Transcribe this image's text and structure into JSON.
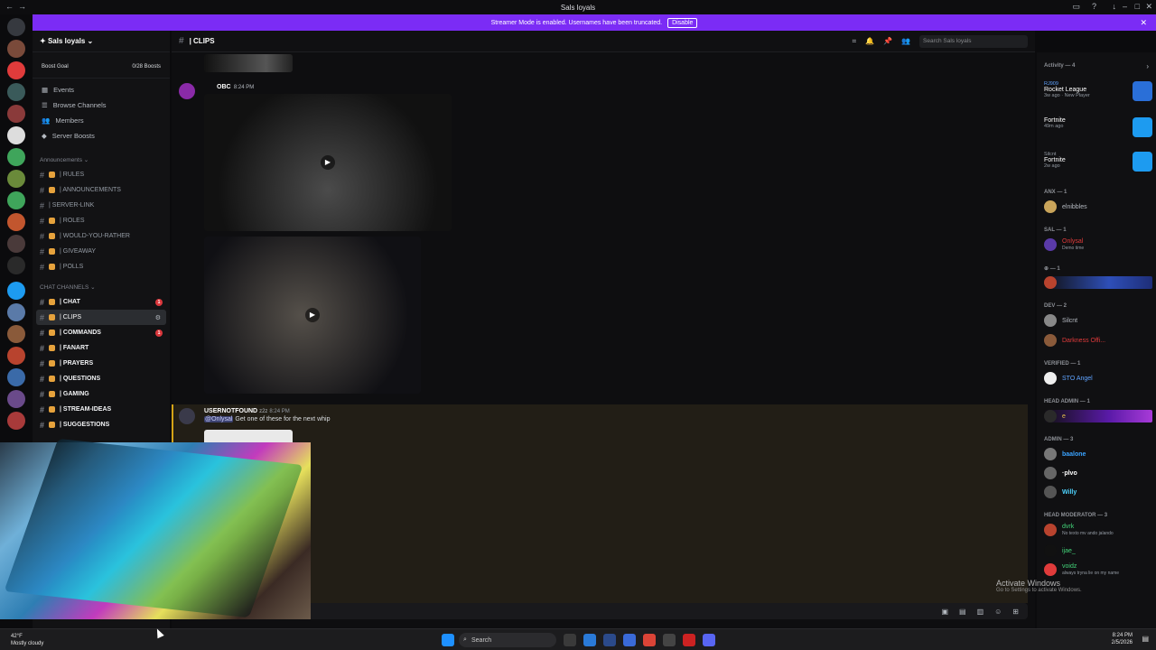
{
  "window": {
    "title": "Sals loyals"
  },
  "banner": {
    "text": "Streamer Mode is enabled. Usernames have been truncated.",
    "button": "Disable"
  },
  "guild": {
    "name": "Sals loyals",
    "boost_label": "Boost Goal",
    "boost_value": "0/28 Boosts"
  },
  "nav": [
    "Events",
    "Browse Channels",
    "Members",
    "Server Boosts"
  ],
  "categories": {
    "announcements": "Announcements",
    "chat": "CHAT CHANNELS"
  },
  "announce_channels": [
    "| RULES",
    "| ANNOUNCEMENTS",
    "| SERVER-LINK",
    "| ROLES",
    "| WOULD-YOU-RATHER",
    "| GIVEAWAY",
    "| POLLS"
  ],
  "chat_channels": [
    "| CHAT",
    "| CLIPS",
    "| COMMANDS",
    "| FANART",
    "| PRAYERS",
    "| QUESTIONS",
    "| GAMING",
    "| STREAM-IDEAS",
    "| SUGGESTIONS"
  ],
  "badges": {
    "chat": "1",
    "commands": "1"
  },
  "header": {
    "channel": "| CLIPS",
    "search_placeholder": "Search Sals loyals"
  },
  "messages": [
    {
      "author": "OBC",
      "time": "8:24 PM"
    },
    {
      "author": "USERNOTFOUND",
      "tag": "z2z",
      "time": "8:24 PM",
      "mention": "@Onlysal",
      "text": "Get one of these for the next whip"
    }
  ],
  "members": {
    "activity_header": "Activity — 4",
    "activities": [
      {
        "user": "RJ909",
        "game": "Rocket League",
        "sub": "3w ago · New Player"
      },
      {
        "user": "",
        "game": "Fortnite",
        "sub": "49m ago"
      },
      {
        "user": "Silcnt",
        "game": "Fortnite",
        "sub": "2w ago"
      }
    ],
    "sections": [
      {
        "title": "ANX — 1",
        "users": [
          {
            "name": "elnibbles",
            "color": "#b5bac1"
          }
        ]
      },
      {
        "title": "SAL — 1",
        "users": [
          {
            "name": "Onlysal",
            "color": "#e23b3b",
            "sub": "Demo time"
          }
        ]
      },
      {
        "title": "⊕ — 1",
        "users": [
          {
            "name": "",
            "color": "#ffffff"
          }
        ]
      },
      {
        "title": "DEV — 2",
        "users": [
          {
            "name": "Silcnt",
            "color": "#b5bac1"
          },
          {
            "name": "Darkness Offi...",
            "color": "#e23b3b"
          }
        ]
      },
      {
        "title": "VERIFIED — 1",
        "users": [
          {
            "name": "STO Angel",
            "color": "#5fa3ff"
          }
        ]
      },
      {
        "title": "HEAD ADMIN — 1",
        "users": [
          {
            "name": "e",
            "color": "#e6c14a"
          }
        ]
      },
      {
        "title": "ADMIN — 3",
        "users": [
          {
            "name": "baalone",
            "color": "#3aa3ff"
          },
          {
            "name": "·plvo",
            "color": "#ffffff"
          },
          {
            "name": "Willy",
            "color": "#4ed4ff"
          }
        ]
      },
      {
        "title": "HEAD MODERATOR — 3",
        "users": [
          {
            "name": "dvrk",
            "color": "#43d67a",
            "sub": "No texto mv ando jalando"
          },
          {
            "name": "ijae_",
            "color": "#43d67a"
          },
          {
            "name": "voidz",
            "color": "#43d67a",
            "sub": "always tryna lie on my name"
          }
        ]
      }
    ]
  },
  "watermark": {
    "title": "Activate Windows",
    "sub": "Go to Settings to activate Windows."
  },
  "taskbar": {
    "search": "Search",
    "weather_temp": "42°F",
    "weather_desc": "Mostly cloudy",
    "time": "8:24 PM",
    "date": "2/5/2026"
  }
}
